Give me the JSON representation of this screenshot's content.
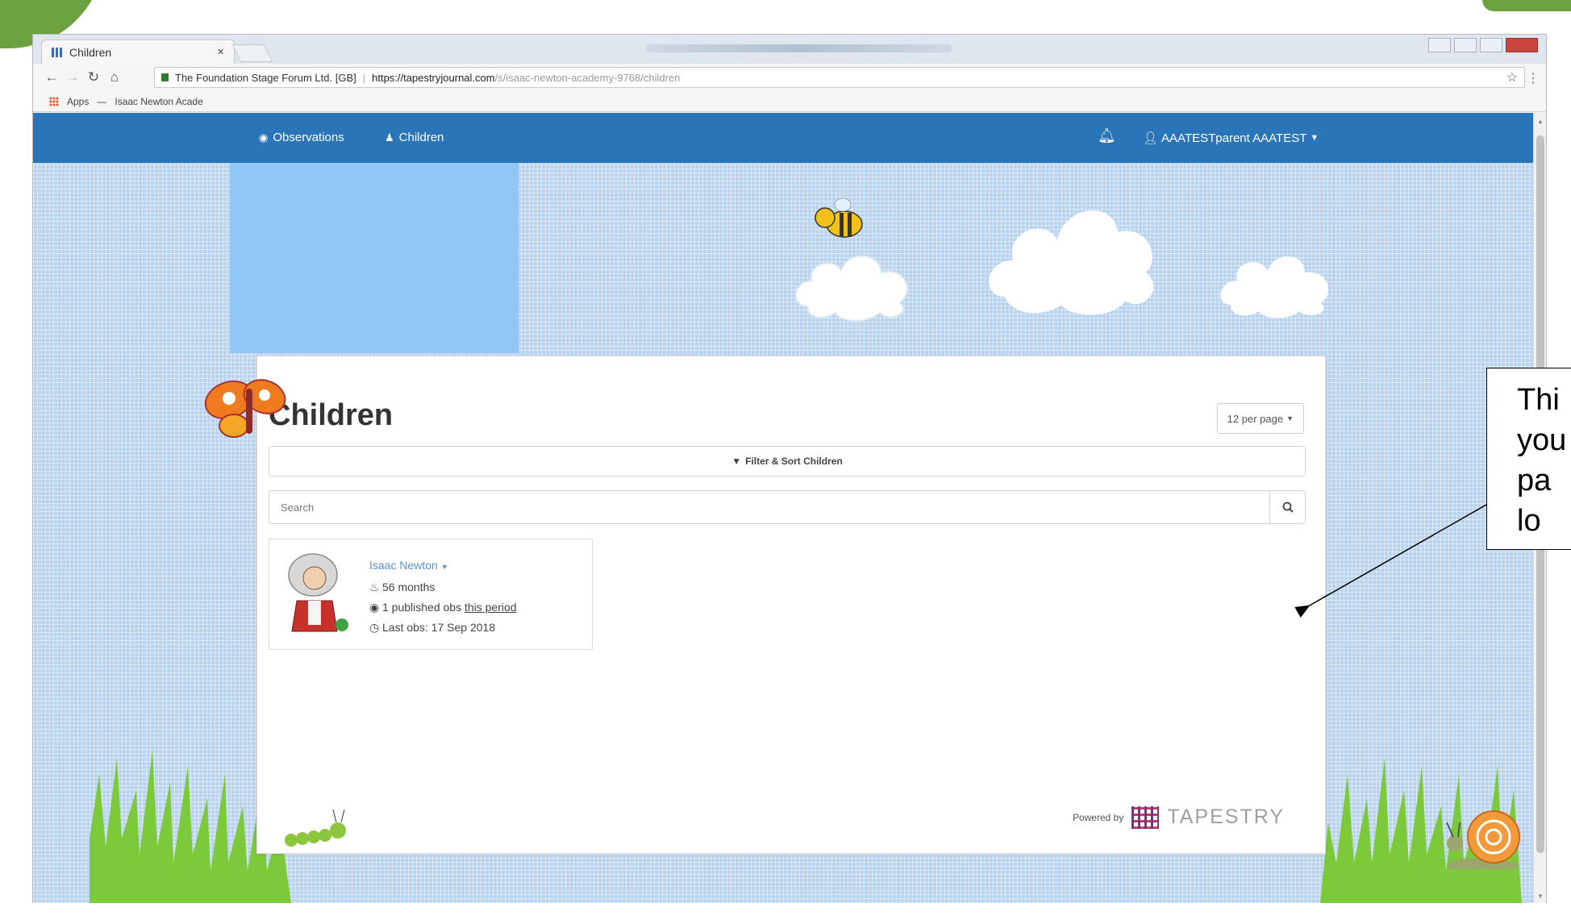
{
  "browser": {
    "tab_title": "Children",
    "tab_close": "×",
    "secure_label": "The Foundation Stage Forum Ltd. [GB]",
    "url_host": "https://tapestryjournal.com",
    "url_path": "/s/isaac-newton-academy-9768/children",
    "bookmarks": [
      "Apps",
      "Isaac Newton Acade"
    ]
  },
  "site_nav": {
    "observations": "Observations",
    "children": "Children",
    "user": "AAATESTparent AAATEST"
  },
  "panel": {
    "title": "Children",
    "per_page": "12 per page",
    "filter_label": "Filter & Sort Children",
    "search_placeholder": "Search"
  },
  "child": {
    "name": "Isaac Newton",
    "age": "56 months",
    "obs_prefix": "1 published obs",
    "obs_link": "this period",
    "last_obs": "Last obs: 17 Sep 2018"
  },
  "footer": {
    "powered_by": "Powered by",
    "brand": "TAPESTRY"
  },
  "callout": {
    "lines": "Thi\nyou\npa\nlo"
  },
  "colors": {
    "nav_blue": "#2a74b8",
    "sky": "#b9d3ef",
    "redaction": "#92c6f6",
    "grass": "#7cc93a",
    "slide_accent": "#6ba23f"
  }
}
